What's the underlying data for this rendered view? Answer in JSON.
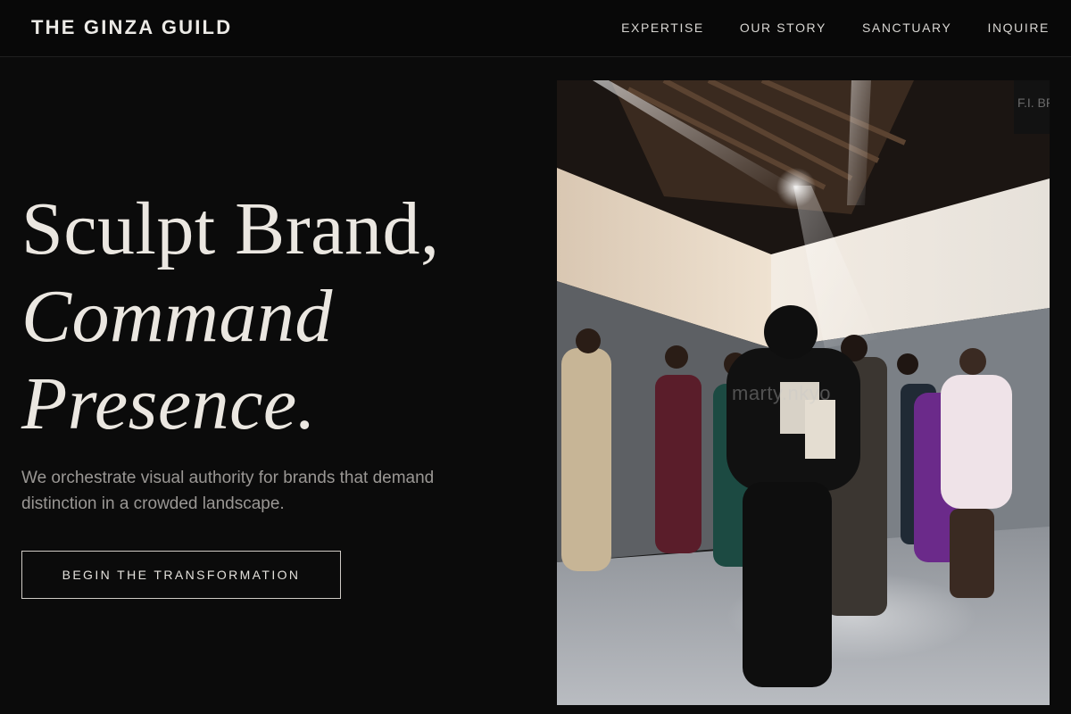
{
  "header": {
    "logo": "THE GINZA GUILD",
    "nav": [
      "EXPERTISE",
      "OUR STORY",
      "SANCTUARY",
      "INQUIRE"
    ]
  },
  "hero": {
    "title_line1": "Sculpt Brand,",
    "title_line2": "Command",
    "title_line3": "Presence.",
    "subtitle": "We orchestrate visual authority for brands that demand distinction in a crowded landscape.",
    "cta_label": "BEGIN THE TRANSFORMATION"
  },
  "photo": {
    "watermark": "marty.nkyo",
    "wall_sign": "F.I. BRA"
  },
  "colors": {
    "background": "#0b0b0b",
    "text": "#e9e6e1",
    "muted": "#9a9794"
  }
}
